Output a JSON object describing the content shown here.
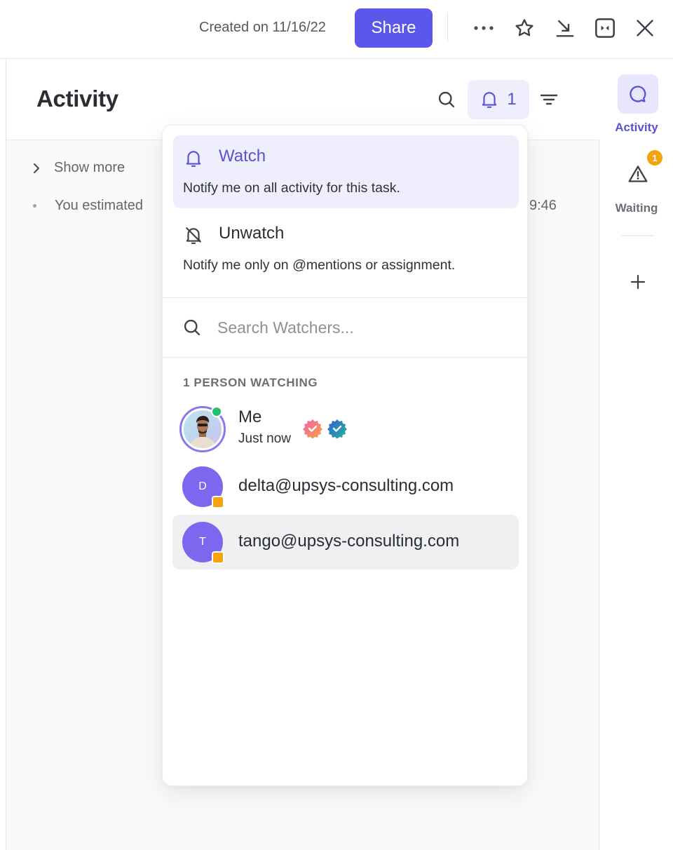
{
  "topbar": {
    "created_label": "Created on 11/16/22",
    "share_label": "Share",
    "icons": [
      "more-icon",
      "star-icon",
      "move-down-icon",
      "collapse-icon",
      "close-icon"
    ]
  },
  "header": {
    "title": "Activity",
    "watchers_count": "1"
  },
  "feed": {
    "show_more": "Show more",
    "item_text": "You estimated",
    "item_time": "9:46"
  },
  "rightbar": {
    "activity_label": "Activity",
    "waiting_label": "Waiting",
    "waiting_badge": "1"
  },
  "dropdown": {
    "watch": {
      "title": "Watch",
      "description": "Notify me on all activity for this task."
    },
    "unwatch": {
      "title": "Unwatch",
      "description": "Notify me only on @mentions or assignment."
    },
    "search_placeholder": "Search Watchers...",
    "section_label": "1 PERSON WATCHING",
    "me": {
      "name": "Me",
      "time": "Just now"
    },
    "watchers": [
      {
        "initial": "D",
        "email": "delta@upsys-consulting.com"
      },
      {
        "initial": "T",
        "email": "tango@upsys-consulting.com"
      }
    ]
  },
  "colors": {
    "accent": "#5b57ea",
    "accent_text": "#5b4fd6",
    "accent_bg": "#efeefc",
    "badge": "#f5a30a",
    "avatar": "#7b68ee",
    "online": "#1fc16b"
  }
}
